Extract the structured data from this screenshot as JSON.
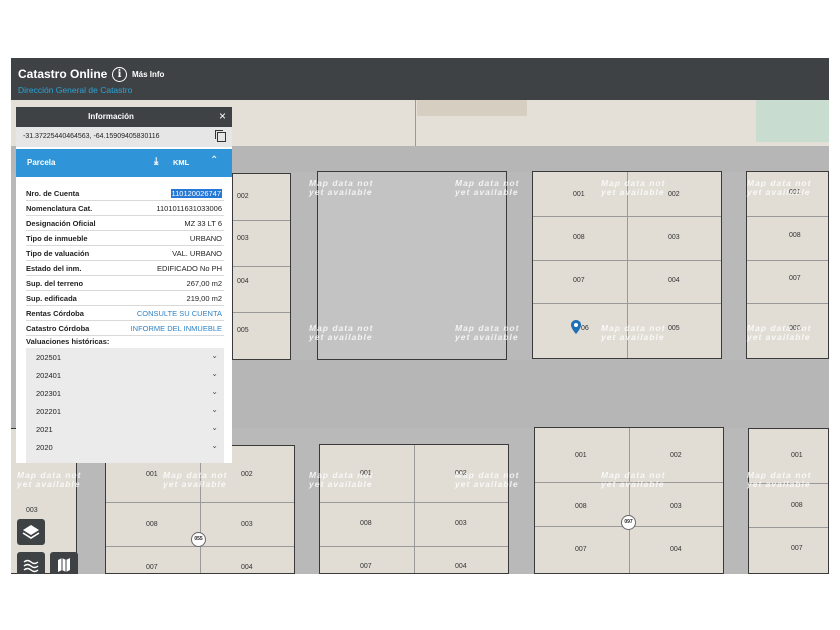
{
  "header": {
    "title": "Catastro Online",
    "mas_info": "Más Info",
    "subtitle": "Dirección General de Catastro"
  },
  "panel": {
    "title": "Información",
    "coords": "-31.37225440464563, -64.15909405830116",
    "section_title": "Parcela",
    "kml_label": "KML",
    "rows": [
      {
        "key": "Nro. de Cuenta",
        "value": "110120026747",
        "selected": true
      },
      {
        "key": "Nomenclatura Cat.",
        "value": "1101011631033006"
      },
      {
        "key": "Designación Oficial",
        "value": "MZ 33 LT 6"
      },
      {
        "key": "Tipo de inmueble",
        "value": "URBANO"
      },
      {
        "key": "Tipo de valuación",
        "value": "VAL. URBANO"
      },
      {
        "key": "Estado del inm.",
        "value": "EDIFICADO No PH"
      },
      {
        "key": "Sup. del terreno",
        "value": "267,00 m2"
      },
      {
        "key": "Sup. edificada",
        "value": "219,00 m2"
      },
      {
        "key": "Rentas Córdoba",
        "value": "CONSULTE SU CUENTA",
        "link": true
      },
      {
        "key": "Catastro Córdoba",
        "value": "INFORME DEL INMUEBLE",
        "link": true
      }
    ],
    "history_label": "Valuaciones históricas:",
    "history": [
      "202501",
      "202401",
      "202301",
      "202201",
      "2021",
      "2020"
    ]
  },
  "map": {
    "no_data": "Map data not\nyet available",
    "lots": {
      "left_block": [
        "002",
        "003",
        "004",
        "005"
      ],
      "right_block_a": [
        "001",
        "002",
        "008",
        "003",
        "007",
        "004",
        "06",
        "005"
      ],
      "far_right_a": [
        "001",
        "008",
        "007",
        "006"
      ],
      "bottom_left": [
        "003"
      ],
      "bottom_a": [
        "001",
        "002",
        "008",
        "003",
        "007",
        "004"
      ],
      "bottom_b": [
        "001",
        "002",
        "008",
        "003",
        "007",
        "004"
      ],
      "bottom_c": [
        "001",
        "002",
        "008",
        "003",
        "007",
        "004"
      ],
      "far_right_b": [
        "001",
        "008",
        "007"
      ]
    },
    "badges": [
      "055",
      "097"
    ]
  },
  "colors": {
    "header": "#3f4245",
    "accent": "#2f95d8",
    "link": "#2f82c5",
    "parcel": "#e1ddd5",
    "road": "#b6b6b6"
  }
}
